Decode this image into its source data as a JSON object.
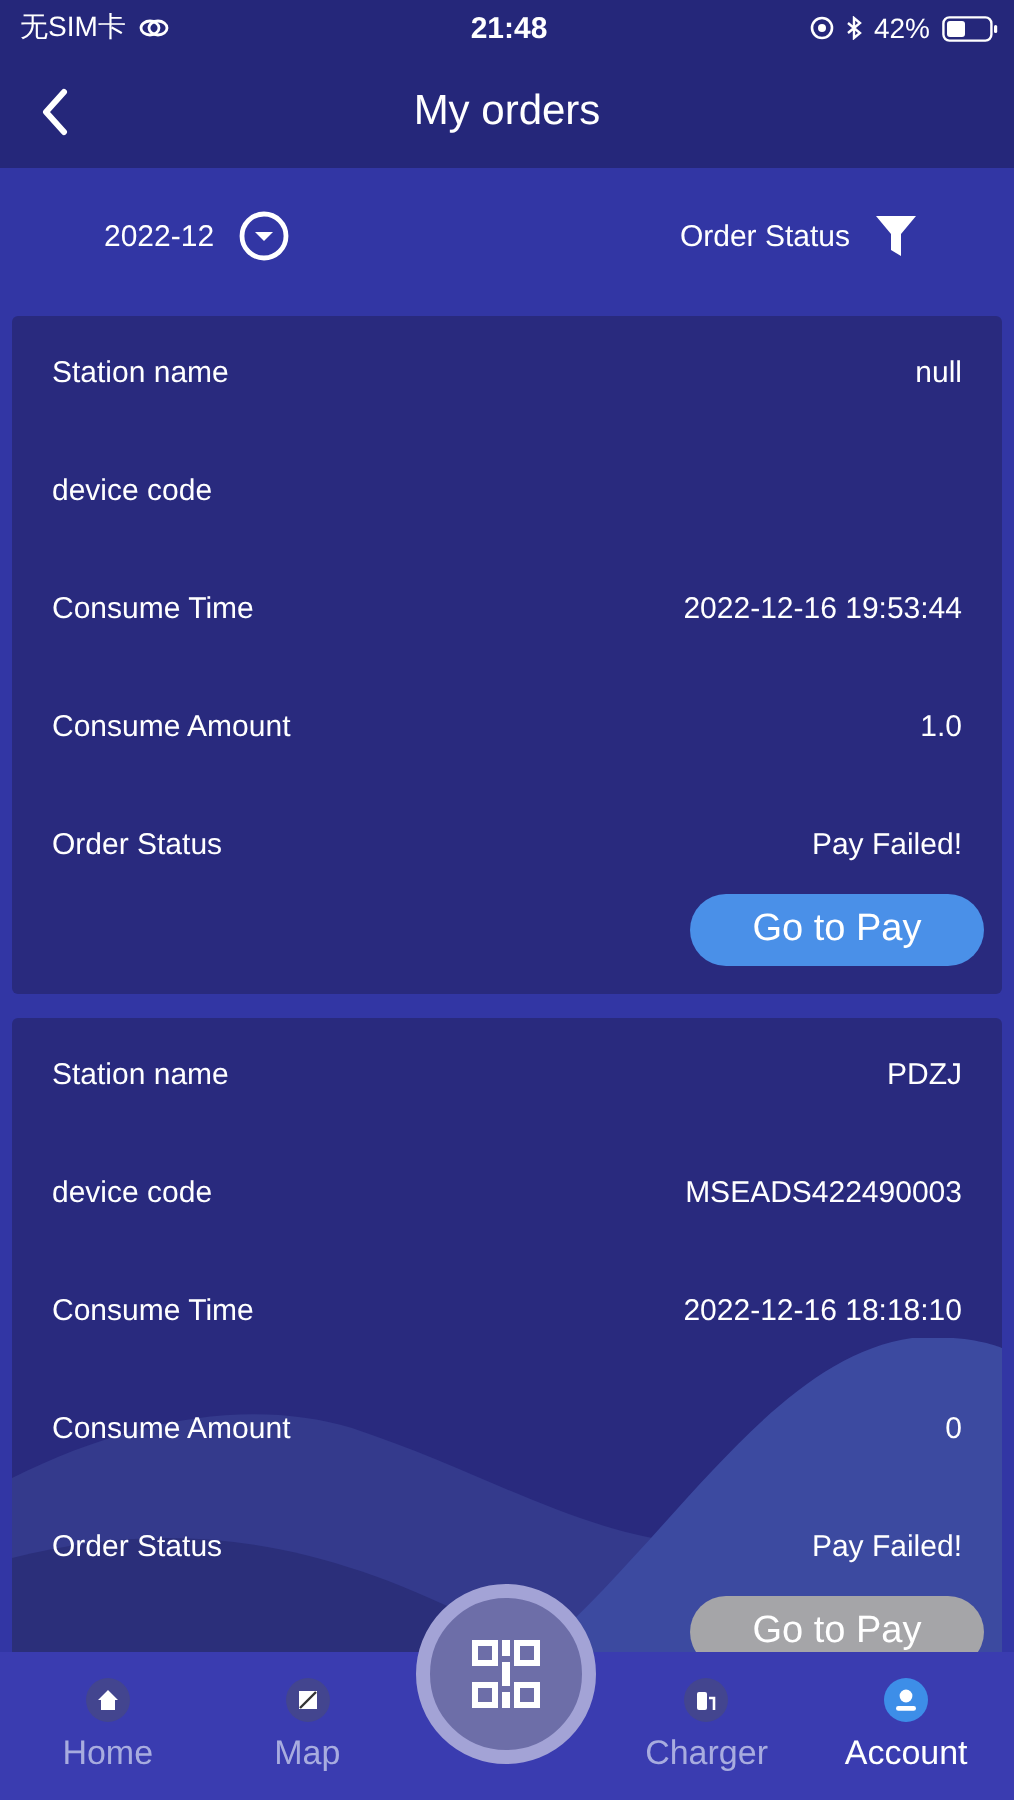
{
  "status_bar": {
    "carrier": "无SIM卡",
    "time": "21:48",
    "battery": "42%"
  },
  "header": {
    "title": "My orders"
  },
  "filters": {
    "month": "2022-12",
    "status_label": "Order Status"
  },
  "orders": [
    {
      "fields": [
        {
          "label": "Station name",
          "value": "null"
        },
        {
          "label": "device code"
        },
        {
          "label": "Consume Time",
          "value": "2022-12-16 19:53:44"
        },
        {
          "label": "Consume Amount",
          "value": "1.0"
        },
        {
          "label": "Order Status",
          "value": "Pay Failed!"
        }
      ],
      "action": {
        "label": "Go to Pay",
        "disabled": false
      }
    },
    {
      "fields": [
        {
          "label": "Station name",
          "value": "PDZJ"
        },
        {
          "label": "device code",
          "value": "MSEADS422490003"
        },
        {
          "label": "Consume Time",
          "value": "2022-12-16 18:18:10"
        },
        {
          "label": "Consume Amount",
          "value": "0"
        },
        {
          "label": "Order Status",
          "value": "Pay Failed!"
        }
      ],
      "action": {
        "label": "Go to Pay",
        "disabled": true
      }
    }
  ],
  "tab_bar": [
    {
      "label": "Home",
      "kind": "home",
      "selected": false
    },
    {
      "label": "Map",
      "kind": "map",
      "selected": false
    },
    {
      "kind": "scan"
    },
    {
      "label": "Charger",
      "kind": "charger",
      "selected": false
    },
    {
      "label": "Account",
      "kind": "account",
      "selected": true
    }
  ]
}
